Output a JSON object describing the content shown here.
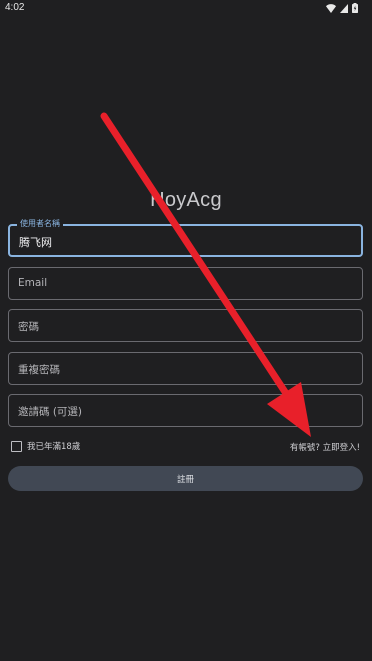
{
  "status_bar": {
    "time": "4:02",
    "icons": [
      "wifi-icon",
      "signal-icon",
      "battery-icon"
    ]
  },
  "app": {
    "title": "HoyAcg"
  },
  "form": {
    "username": {
      "label": "使用者名稱",
      "value": "腾飞网"
    },
    "email": {
      "placeholder": "Email"
    },
    "password": {
      "placeholder": "密碼"
    },
    "confirm_password": {
      "placeholder": "重複密碼"
    },
    "invite_code": {
      "placeholder": "邀請碼 (可選)"
    },
    "age_checkbox": {
      "label": "我已年滿18歲",
      "checked": false
    },
    "login_link": "有帳號? 立即登入!",
    "register_button": "註冊"
  },
  "colors": {
    "background": "#1f1f21",
    "focus_accent": "#8ab4e0",
    "button": "#414854",
    "annotation_arrow": "#e8202a"
  }
}
